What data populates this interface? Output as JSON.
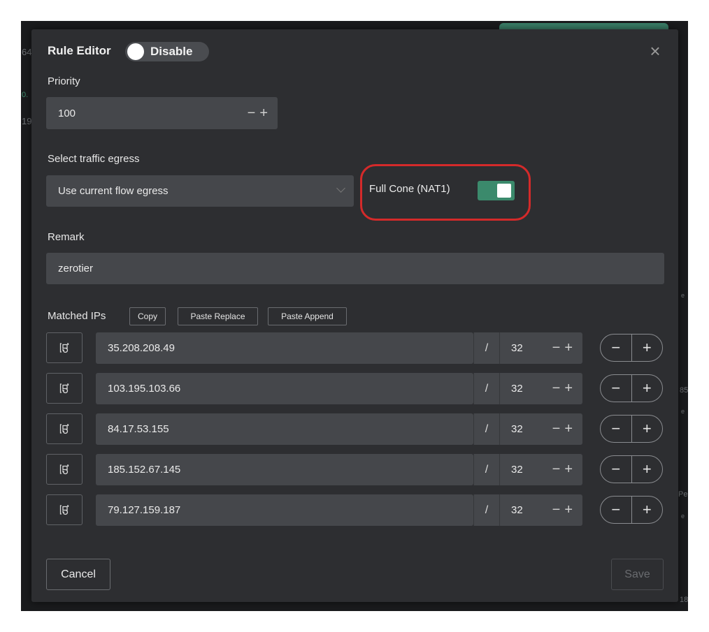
{
  "dialog": {
    "title": "Rule Editor",
    "enable_toggle": {
      "label": "Disable",
      "state": "off"
    },
    "close_icon": "close-icon"
  },
  "priority": {
    "label": "Priority",
    "value": "100",
    "decrement": "−",
    "increment": "+"
  },
  "egress": {
    "label": "Select traffic egress",
    "selected": "Use current flow egress",
    "full_cone": {
      "label": "Full Cone (NAT1)",
      "enabled": true,
      "highlight_color": "#d42a2a"
    }
  },
  "remark": {
    "label": "Remark",
    "value": "zerotier"
  },
  "matched_ips": {
    "label": "Matched IPs",
    "buttons": {
      "copy": "Copy",
      "paste_replace": "Paste Replace",
      "paste_append": "Paste Append"
    },
    "separator": "/",
    "rows": [
      {
        "ip": "35.208.208.49",
        "prefix": "32"
      },
      {
        "ip": "103.195.103.66",
        "prefix": "32"
      },
      {
        "ip": "84.17.53.155",
        "prefix": "32"
      },
      {
        "ip": "185.152.67.145",
        "prefix": "32"
      },
      {
        "ip": "79.127.159.187",
        "prefix": "32"
      }
    ],
    "row_icon": "file-sync-icon",
    "stepper_minus": "−",
    "stepper_plus": "+"
  },
  "footer": {
    "cancel": "Cancel",
    "save": "Save"
  },
  "colors": {
    "accent": "#3b8a6c",
    "dialog_bg": "#2d2e31",
    "field_bg": "#45474b"
  },
  "background_fragments": [
    "64",
    "0.",
    "19",
    "85",
    "e",
    "e",
    "Pe",
    "e",
    "18"
  ]
}
